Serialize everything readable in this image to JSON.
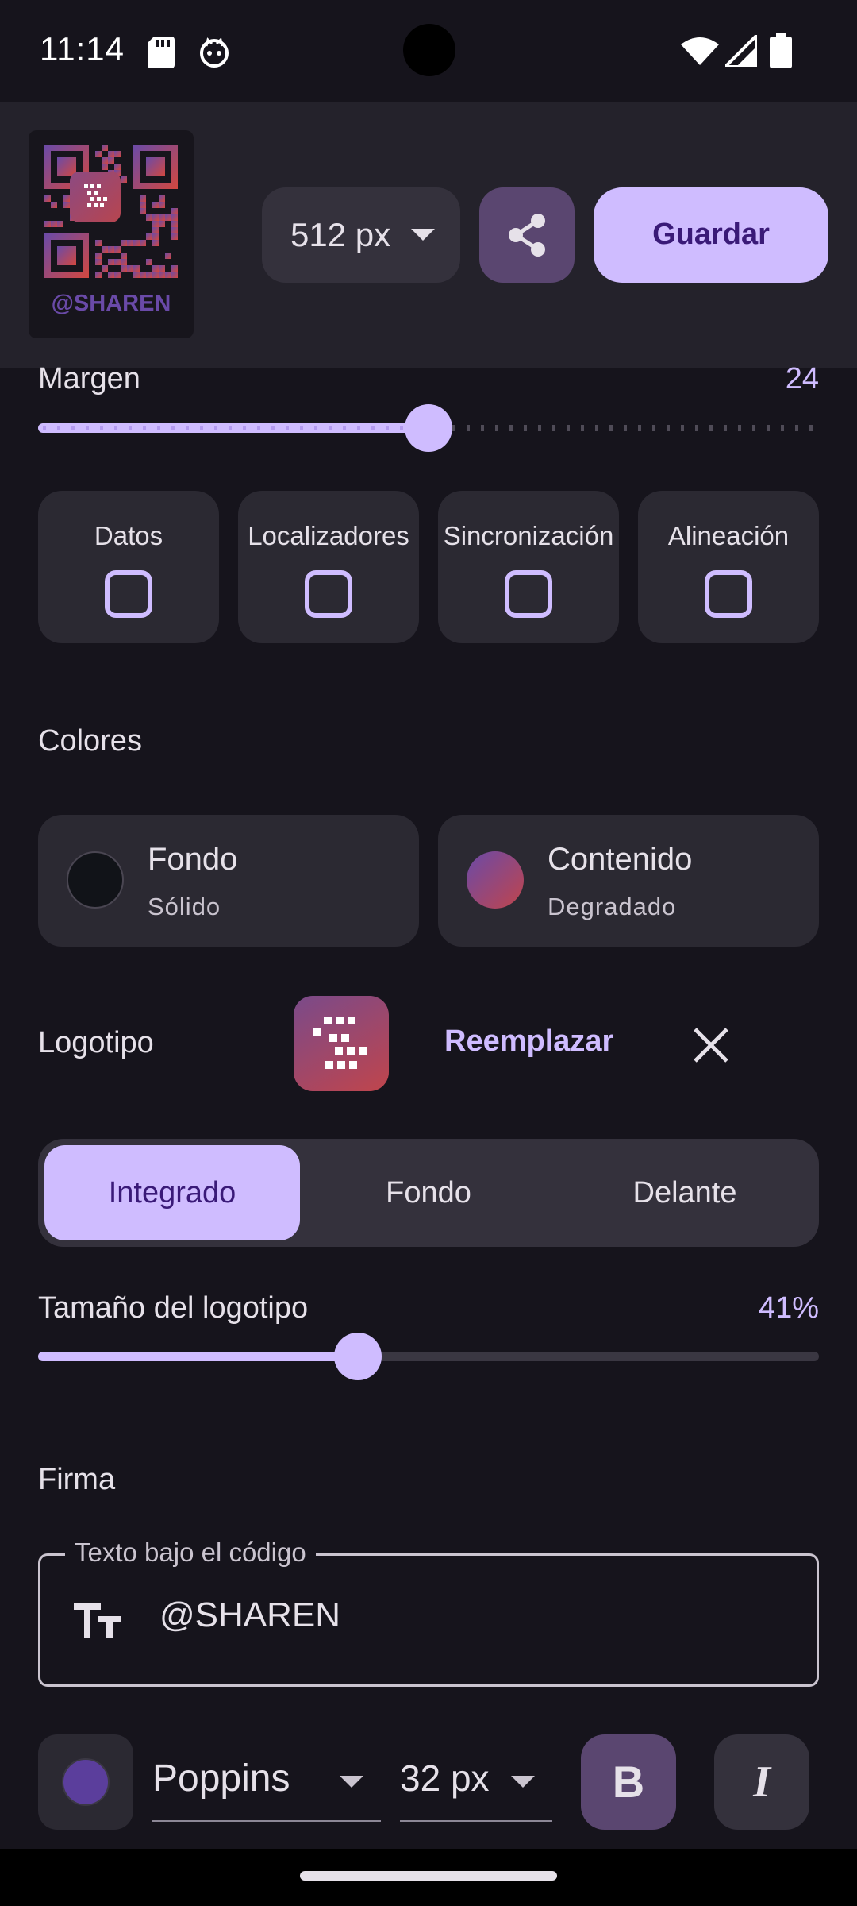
{
  "status_bar": {
    "time": "11:14"
  },
  "toolbar": {
    "qr_signature": "@SHAREN",
    "size_value": "512 px",
    "save_label": "Guardar"
  },
  "margin": {
    "label": "Margen",
    "value_label": "24",
    "value": 24,
    "fraction": 0.5
  },
  "options": [
    {
      "label": "Datos",
      "checked": false
    },
    {
      "label": "Localizadores",
      "checked": false
    },
    {
      "label": "Sincronización",
      "checked": false
    },
    {
      "label": "Alineación",
      "checked": false
    }
  ],
  "colors": {
    "title": "Colores",
    "background": {
      "title": "Fondo",
      "subtitle": "Sólido",
      "color": "#111318"
    },
    "content": {
      "title": "Contenido",
      "subtitle": "Degradado",
      "color_start": "#6a4aa8",
      "color_end": "#c0454c"
    }
  },
  "logo": {
    "title": "Logotipo",
    "replace_label": "Reemplazar",
    "modes": [
      "Integrado",
      "Fondo",
      "Delante"
    ],
    "active_mode": "Integrado",
    "size_label": "Tamaño del logotipo",
    "size_value_label": "41%",
    "size_fraction": 0.41
  },
  "signature": {
    "title": "Firma",
    "field_label": "Texto bajo el código",
    "field_value": "@SHAREN",
    "text_color": "#5b3e9c",
    "font": "Poppins",
    "font_size": "32 px",
    "bold_label": "B",
    "italic_label": "I",
    "bold_active": true
  },
  "accent_color": "#cfbcff"
}
